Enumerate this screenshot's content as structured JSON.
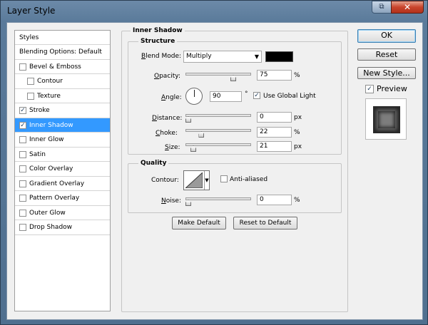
{
  "window": {
    "title": "Layer Style"
  },
  "styles_panel": {
    "header": "Styles",
    "items": [
      {
        "label": "Blending Options: Default",
        "checkbox": false,
        "checked": false,
        "indent": 0,
        "selected": false
      },
      {
        "label": "Bevel & Emboss",
        "checkbox": true,
        "checked": false,
        "indent": 0,
        "selected": false
      },
      {
        "label": "Contour",
        "checkbox": true,
        "checked": false,
        "indent": 1,
        "selected": false
      },
      {
        "label": "Texture",
        "checkbox": true,
        "checked": false,
        "indent": 1,
        "selected": false
      },
      {
        "label": "Stroke",
        "checkbox": true,
        "checked": true,
        "indent": 0,
        "selected": false
      },
      {
        "label": "Inner Shadow",
        "checkbox": true,
        "checked": true,
        "indent": 0,
        "selected": true
      },
      {
        "label": "Inner Glow",
        "checkbox": true,
        "checked": false,
        "indent": 0,
        "selected": false
      },
      {
        "label": "Satin",
        "checkbox": true,
        "checked": false,
        "indent": 0,
        "selected": false
      },
      {
        "label": "Color Overlay",
        "checkbox": true,
        "checked": false,
        "indent": 0,
        "selected": false
      },
      {
        "label": "Gradient Overlay",
        "checkbox": true,
        "checked": false,
        "indent": 0,
        "selected": false
      },
      {
        "label": "Pattern Overlay",
        "checkbox": true,
        "checked": false,
        "indent": 0,
        "selected": false
      },
      {
        "label": "Outer Glow",
        "checkbox": true,
        "checked": false,
        "indent": 0,
        "selected": false
      },
      {
        "label": "Drop Shadow",
        "checkbox": true,
        "checked": false,
        "indent": 0,
        "selected": false
      }
    ]
  },
  "inner_shadow": {
    "group_title": "Inner Shadow",
    "structure": {
      "title": "Structure",
      "blend_mode": {
        "label": "Blend Mode:",
        "value": "Multiply",
        "color": "#000000"
      },
      "opacity": {
        "label": "Opacity:",
        "value": "75",
        "unit": "%",
        "level": 0.75
      },
      "angle": {
        "label": "Angle:",
        "value": "90",
        "unit": "°"
      },
      "use_global_light": {
        "label": "Use Global Light",
        "checked": true
      },
      "distance": {
        "label": "Distance:",
        "value": "0",
        "unit": "px",
        "level": 0
      },
      "choke": {
        "label": "Choke:",
        "value": "22",
        "unit": "%",
        "level": 0.22
      },
      "size": {
        "label": "Size:",
        "value": "21",
        "unit": "px",
        "level": 0.084
      }
    },
    "quality": {
      "title": "Quality",
      "contour": {
        "label": "Contour:"
      },
      "anti_aliased": {
        "label": "Anti-aliased",
        "checked": false
      },
      "noise": {
        "label": "Noise:",
        "value": "0",
        "unit": "%",
        "level": 0
      }
    },
    "make_default": "Make Default",
    "reset_to_default": "Reset to Default"
  },
  "actions": {
    "ok": "OK",
    "reset": "Reset",
    "new_style": "New Style...",
    "preview": {
      "label": "Preview",
      "checked": true
    }
  },
  "icons": {
    "help": "help-icon",
    "close": "close-icon"
  }
}
